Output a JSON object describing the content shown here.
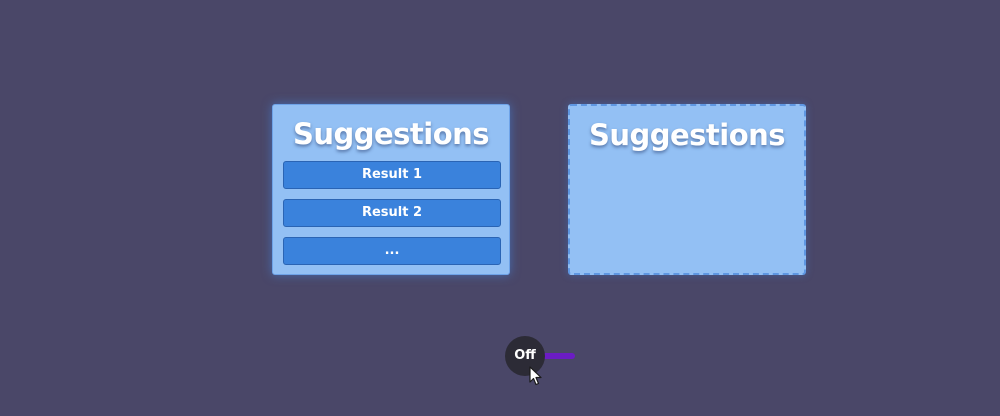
{
  "panels": [
    {
      "title": "Suggestions",
      "results": [
        "Result 1",
        "Result 2",
        "..."
      ]
    },
    {
      "title": "Suggestions"
    }
  ],
  "toggle": {
    "label": "Off",
    "track_color": "#6b1cc4"
  },
  "colors": {
    "background": "#4a4768",
    "panel": "#93c0f4",
    "result_item": "#3a82dc"
  },
  "icons": {
    "pointer": "arrow-cursor-icon"
  }
}
